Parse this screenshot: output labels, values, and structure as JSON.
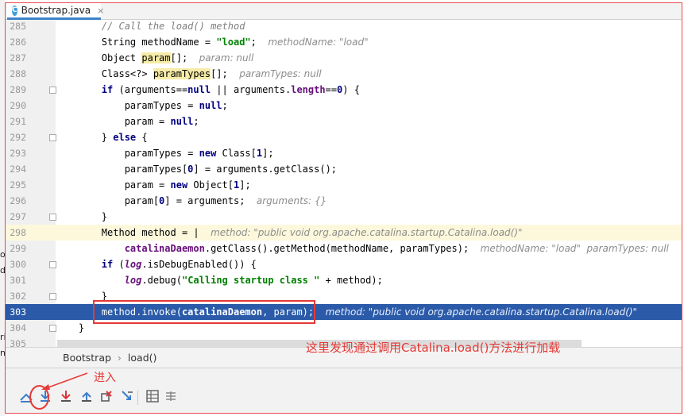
{
  "tab": {
    "label": "Bootstrap.java",
    "icon": "class-c-icon",
    "close": "×"
  },
  "left_fragments": [
    "oi",
    "d",
    "ri",
    "ng"
  ],
  "lines": [
    {
      "num": "285",
      "segments": [
        {
          "t": "        "
        },
        {
          "t": "// Call the load() method",
          "c": "cmt"
        }
      ]
    },
    {
      "num": "286",
      "segments": [
        {
          "t": "        String methodName = "
        },
        {
          "t": "\"load\"",
          "c": "str"
        },
        {
          "t": ";  "
        },
        {
          "t": "methodName: \"load\"",
          "c": "hint"
        }
      ]
    },
    {
      "num": "287",
      "segments": [
        {
          "t": "        Object "
        },
        {
          "t": "param",
          "c": "hl"
        },
        {
          "t": "[];  "
        },
        {
          "t": "param: null",
          "c": "hint"
        }
      ]
    },
    {
      "num": "288",
      "segments": [
        {
          "t": "        Class<?> "
        },
        {
          "t": "paramTypes",
          "c": "hl"
        },
        {
          "t": "[];  "
        },
        {
          "t": "paramTypes: null",
          "c": "hint"
        }
      ]
    },
    {
      "num": "289",
      "segments": [
        {
          "t": "        "
        },
        {
          "t": "if",
          "c": "kw"
        },
        {
          "t": " (arguments=="
        },
        {
          "t": "null",
          "c": "kw"
        },
        {
          "t": " || arguments."
        },
        {
          "t": "length",
          "c": "fld"
        },
        {
          "t": "=="
        },
        {
          "t": "0",
          "c": "kw"
        },
        {
          "t": ") {"
        }
      ]
    },
    {
      "num": "290",
      "segments": [
        {
          "t": "            paramTypes = "
        },
        {
          "t": "null",
          "c": "kw"
        },
        {
          "t": ";"
        }
      ]
    },
    {
      "num": "291",
      "segments": [
        {
          "t": "            param = "
        },
        {
          "t": "null",
          "c": "kw"
        },
        {
          "t": ";"
        }
      ]
    },
    {
      "num": "292",
      "segments": [
        {
          "t": "        } "
        },
        {
          "t": "else",
          "c": "kw"
        },
        {
          "t": " {"
        }
      ]
    },
    {
      "num": "293",
      "segments": [
        {
          "t": "            paramTypes = "
        },
        {
          "t": "new",
          "c": "kw"
        },
        {
          "t": " Class["
        },
        {
          "t": "1",
          "c": "kw"
        },
        {
          "t": "];"
        }
      ]
    },
    {
      "num": "294",
      "segments": [
        {
          "t": "            paramTypes["
        },
        {
          "t": "0",
          "c": "kw"
        },
        {
          "t": "] = arguments.getClass();"
        }
      ]
    },
    {
      "num": "295",
      "segments": [
        {
          "t": "            param = "
        },
        {
          "t": "new",
          "c": "kw"
        },
        {
          "t": " Object["
        },
        {
          "t": "1",
          "c": "kw"
        },
        {
          "t": "];"
        }
      ]
    },
    {
      "num": "296",
      "segments": [
        {
          "t": "            param["
        },
        {
          "t": "0",
          "c": "kw"
        },
        {
          "t": "] = arguments;  "
        },
        {
          "t": "arguments: {}",
          "c": "hint"
        }
      ]
    },
    {
      "num": "297",
      "segments": [
        {
          "t": "        }"
        }
      ]
    },
    {
      "num": "298",
      "segments": [
        {
          "t": "        Method method = "
        },
        {
          "t": "|  "
        },
        {
          "t": "method: \"public void org.apache.catalina.startup.Catalina.load()\"",
          "c": "hint"
        }
      ]
    },
    {
      "num": "299",
      "segments": [
        {
          "t": "            "
        },
        {
          "t": "catalinaDaemon",
          "c": "fld"
        },
        {
          "t": ".getClass().getMethod(methodName, paramTypes);  "
        },
        {
          "t": "methodName: \"load\"  paramTypes: null",
          "c": "hint"
        }
      ]
    },
    {
      "num": "300",
      "segments": [
        {
          "t": "        "
        },
        {
          "t": "if",
          "c": "kw"
        },
        {
          "t": " ("
        },
        {
          "t": "log",
          "c": "ital"
        },
        {
          "t": ".isDebugEnabled()) {"
        }
      ]
    },
    {
      "num": "301",
      "segments": [
        {
          "t": "            "
        },
        {
          "t": "log",
          "c": "ital"
        },
        {
          "t": ".debug("
        },
        {
          "t": "\"Calling startup class \"",
          "c": "str"
        },
        {
          "t": " + method);"
        }
      ]
    },
    {
      "num": "302",
      "segments": [
        {
          "t": "        }"
        }
      ]
    },
    {
      "num": "303",
      "segments": [
        {
          "t": "        method.invoke("
        },
        {
          "t": "catalinaDaemon",
          "c": "fld"
        },
        {
          "t": ", param);  "
        },
        {
          "t": "method: \"public void org.apache.catalina.startup.Catalina.load()\"",
          "c": "hint"
        }
      ]
    },
    {
      "num": "304",
      "segments": [
        {
          "t": "    }"
        }
      ]
    },
    {
      "num": "305",
      "segments": [
        {
          "t": ""
        }
      ]
    }
  ],
  "current_line": "298",
  "exec_line": "303",
  "breadcrumb": {
    "items": [
      "Bootstrap",
      "load()"
    ],
    "separator": "›"
  },
  "annotations": {
    "note": "这里发现通过调用Catalina.load()方法进行加载",
    "enter": "进入",
    "color": "#e53935"
  },
  "toolbar": {
    "buttons": [
      {
        "name": "show-execution-point-icon",
        "label": "Show Execution Point"
      },
      {
        "name": "step-over-icon",
        "label": "Step Over"
      },
      {
        "name": "step-into-icon",
        "label": "Step Into"
      },
      {
        "name": "force-step-into-icon",
        "label": "Force Step Into"
      },
      {
        "name": "step-out-icon",
        "label": "Step Out"
      },
      {
        "name": "drop-frame-icon",
        "label": "Drop Frame"
      },
      {
        "name": "run-to-cursor-icon",
        "label": "Run to Cursor"
      },
      {
        "name": "evaluate-expression-icon",
        "label": "Evaluate Expression"
      },
      {
        "name": "trace-current-stream-icon",
        "label": "Trace Current Stream Chain"
      }
    ]
  },
  "colors": {
    "exec_highlight": "#2a5aa8",
    "current_line": "#fdf8dc",
    "accent": "#4083c9"
  }
}
